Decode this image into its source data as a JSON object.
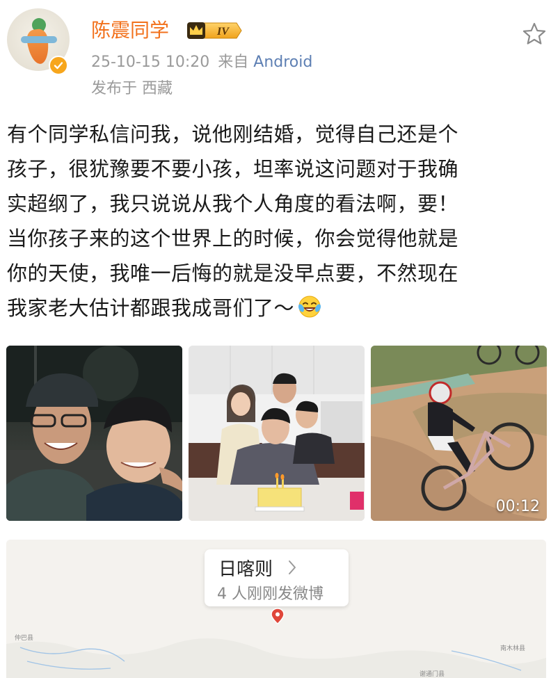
{
  "header": {
    "username": "陈震同学",
    "vip_level": "IV",
    "timestamp": "25-10-15 10:20",
    "source_prefix": "来自",
    "source": "Android",
    "location": "发布于 西藏"
  },
  "post": {
    "lines": [
      "有个同学私信问我，说他刚结婚，觉得自己还是个",
      "孩子，很犹豫要不要小孩，坦率说这问题对于我确",
      "实超纲了，我只说说从我个人角度的看法啊，要！",
      "当你孩子来的这个世界上的时候，你会觉得他就是",
      "你的天使，我唯一后悔的就是没早点要，不然现在",
      "我家老大估计都跟我成哥们了～"
    ],
    "emoji": "laughing-tears-emoji"
  },
  "media": {
    "video_duration": "00:12"
  },
  "map": {
    "place": "日喀则",
    "count_text": "4 人刚刚发微博",
    "labels": {
      "left": "仲巴县",
      "right": "南木林县",
      "bottom": "谢通门县"
    }
  },
  "colors": {
    "username": "#f2711c",
    "meta": "#9a9a9a",
    "source_link": "#5d7fb3",
    "text": "#1a1a1a",
    "verified_badge": "#f7a61c"
  }
}
